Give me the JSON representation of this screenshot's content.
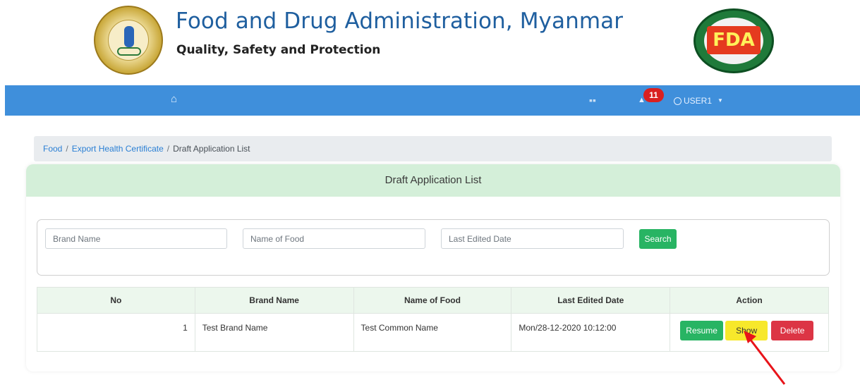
{
  "header": {
    "title": "Food and Drug Administration, Myanmar",
    "subtitle": "Quality, Safety and Protection",
    "logo_left_icon": "ministry-of-health-seal",
    "logo_right_text": "FDA"
  },
  "navbar": {
    "home_icon": "home-icon",
    "book_icon": "book-icon",
    "bell_icon": "bell-icon",
    "notification_count": "11",
    "user_label": "USER1"
  },
  "breadcrumb": {
    "items": [
      "Food",
      "Export Health Certificate"
    ],
    "current": "Draft Application List"
  },
  "card": {
    "title": "Draft Application List"
  },
  "search": {
    "brand_placeholder": "Brand Name",
    "food_placeholder": "Name of Food",
    "date_placeholder": "Last Edited Date",
    "button_label": "Search"
  },
  "table": {
    "headers": [
      "No",
      "Brand Name",
      "Name of Food",
      "Last Edited Date",
      "Action"
    ],
    "rows": [
      {
        "no": "1",
        "brand": "Test Brand Name",
        "food": "Test Common Name",
        "date": "Mon/28-12-2020 10:12:00",
        "actions": [
          "Resume",
          "Show",
          "Delete"
        ]
      }
    ]
  },
  "colors": {
    "navbar": "#3f8fdb",
    "card_header": "#d4efd9",
    "success": "#28b463",
    "warning": "#f7e82b",
    "danger": "#dc3545",
    "annotation_arrow": "#e8141a"
  }
}
